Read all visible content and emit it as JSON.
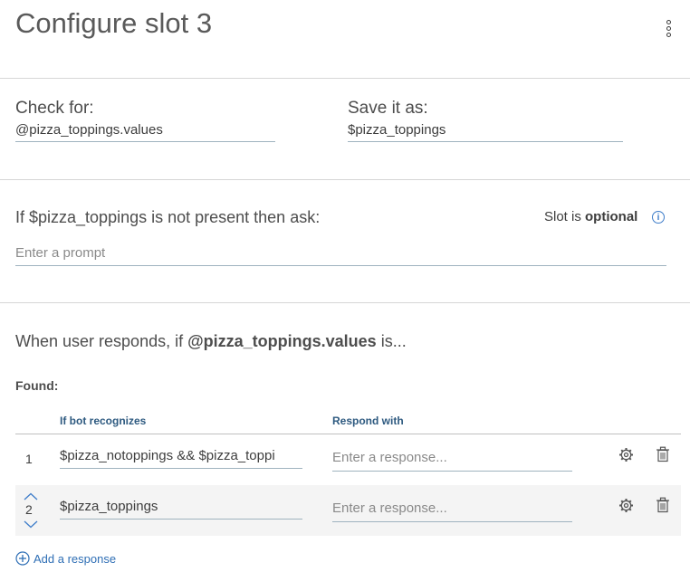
{
  "header": {
    "title": "Configure slot 3"
  },
  "slot": {
    "check_for_label": "Check for:",
    "check_for_value": "@pizza_toppings.values",
    "save_as_label": "Save it as:",
    "save_as_value": "$pizza_toppings"
  },
  "prompt": {
    "question": "If $pizza_toppings is not present then ask:",
    "optional_prefix": "Slot is ",
    "optional_word": "optional",
    "placeholder": "Enter a prompt"
  },
  "responses": {
    "intro_prefix": "When user responds, if ",
    "intro_entity": "@pizza_toppings.values",
    "intro_suffix": " is...",
    "found_label": "Found:",
    "col_recognizes": "If bot recognizes",
    "col_respond": "Respond with",
    "rows": [
      {
        "num": "1",
        "condition": "$pizza_notoppings && $pizza_toppi",
        "response_placeholder": "Enter a response..."
      },
      {
        "num": "2",
        "condition": "$pizza_toppings",
        "response_placeholder": "Enter a response..."
      }
    ],
    "add_label": "Add a response"
  },
  "icons": {
    "menu": "overflow-menu-icon",
    "info": "info-icon",
    "settings": "gear-icon",
    "delete": "trash-icon",
    "up": "chevron-up-icon",
    "down": "chevron-down-icon",
    "add": "add-circle-icon"
  },
  "colors": {
    "accent": "#3d7cc9",
    "link": "#2f6fb5",
    "column_header": "#2e5a80"
  }
}
